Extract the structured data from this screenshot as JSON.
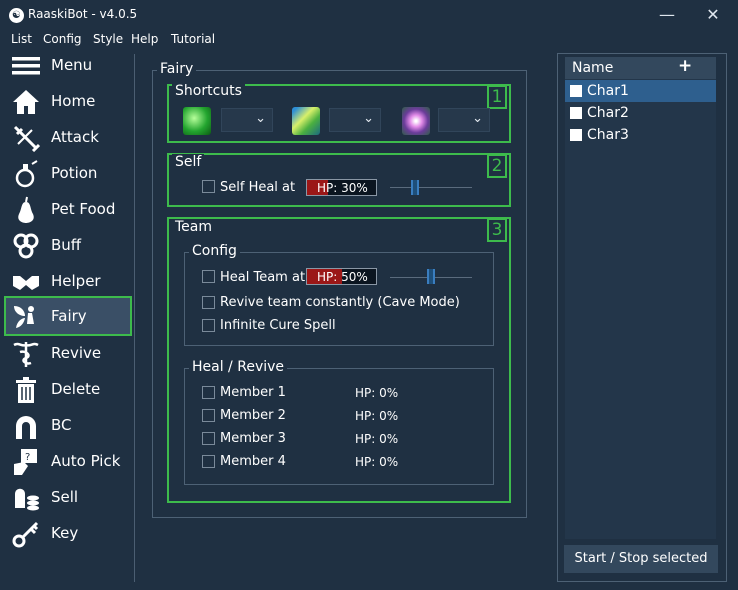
{
  "window": {
    "title": "RaaskiBot - v4.0.5",
    "minimize_glyph": "—",
    "close_glyph": "✕"
  },
  "menubar": [
    "List",
    "Config",
    "Style",
    "Help",
    "Tutorial"
  ],
  "sidebar": {
    "items": [
      {
        "label": "Menu",
        "icon": "hamburger-icon"
      },
      {
        "label": "Home",
        "icon": "house-icon"
      },
      {
        "label": "Attack",
        "icon": "swords-icon"
      },
      {
        "label": "Potion",
        "icon": "potion-icon"
      },
      {
        "label": "Pet Food",
        "icon": "pear-icon"
      },
      {
        "label": "Buff",
        "icon": "triskelion-icon"
      },
      {
        "label": "Helper",
        "icon": "handshake-icon"
      },
      {
        "label": "Fairy",
        "icon": "fairy-icon"
      },
      {
        "label": "Revive",
        "icon": "caduceus-icon"
      },
      {
        "label": "Delete",
        "icon": "trash-icon"
      },
      {
        "label": "BC",
        "icon": "horseshoe-icon"
      },
      {
        "label": "Auto Pick",
        "icon": "hand-card-icon"
      },
      {
        "label": "Sell",
        "icon": "coins-icon"
      },
      {
        "label": "Key",
        "icon": "key-icon"
      }
    ],
    "active": "Fairy"
  },
  "fairy": {
    "title": "Fairy",
    "shortcuts": {
      "title": "Shortcuts",
      "badge": "1",
      "slots": [
        {
          "icon": "green-skill-icon",
          "value": ""
        },
        {
          "icon": "wind-skill-icon",
          "value": ""
        },
        {
          "icon": "purple-flower-skill-icon",
          "value": ""
        }
      ]
    },
    "self": {
      "title": "Self",
      "badge": "2",
      "self_heal_label": "Self Heal at",
      "hp_text": "HP: 30%",
      "hp_fraction": 0.3,
      "slider_fraction": 0.3
    },
    "team": {
      "title": "Team",
      "badge": "3",
      "config": {
        "title": "Config",
        "heal_team_label": "Heal Team at",
        "hp_text": "HP: 50%",
        "hp_fraction": 0.5,
        "slider_fraction": 0.5,
        "revive_label": "Revive team constantly (Cave Mode)",
        "infinite_cure_label": "Infinite Cure Spell"
      },
      "heal_revive": {
        "title": "Heal / Revive",
        "members": [
          {
            "name": "Member 1",
            "hp": "HP: 0%"
          },
          {
            "name": "Member 2",
            "hp": "HP: 0%"
          },
          {
            "name": "Member 3",
            "hp": "HP: 0%"
          },
          {
            "name": "Member 4",
            "hp": "HP: 0%"
          }
        ]
      }
    }
  },
  "char_list": {
    "header": "Name",
    "add_glyph": "+",
    "rows": [
      {
        "name": "Char1",
        "selected": true
      },
      {
        "name": "Char2",
        "selected": false
      },
      {
        "name": "Char3",
        "selected": false
      }
    ],
    "start_stop_label": "Start / Stop selected"
  },
  "colors": {
    "background": "#1f3042",
    "accent_green": "#3dbb4c",
    "selection_blue": "#2e5f8e",
    "hp_red": "#9b1717"
  }
}
